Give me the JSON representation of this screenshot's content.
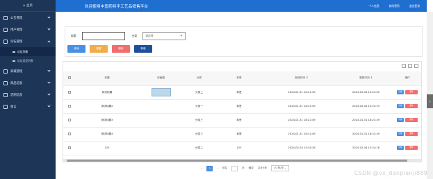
{
  "sidebar": {
    "home_label": "主页",
    "groups": [
      {
        "label": "公告管理",
        "icon": "grid-icon"
      },
      {
        "label": "用户管理",
        "icon": "grid-icon"
      },
      {
        "label": "论坛管理",
        "icon": "grid-icon",
        "open": true,
        "children": [
          {
            "label": "论坛列表",
            "active": true
          },
          {
            "label": "论坛类型列表",
            "active": false
          }
        ]
      },
      {
        "label": "商城管理",
        "icon": "grid-icon"
      },
      {
        "label": "商品信息",
        "icon": "grid-icon"
      },
      {
        "label": "定制信息",
        "icon": "grid-icon"
      },
      {
        "label": "留言",
        "icon": "grid-icon"
      }
    ]
  },
  "topbar": {
    "title": "欢迎使用中国药特手工艺品销售平台",
    "nav": [
      "个人信息",
      "修改密码",
      "退出登录"
    ]
  },
  "filter": {
    "title_label": "标题",
    "type_label": "分类",
    "type_placeholder": "请选择",
    "buttons": {
      "search": "查询",
      "reset": "重置",
      "delete": "删除",
      "add": "新增"
    }
  },
  "table": {
    "headers": [
      "",
      "标题",
      "封面图",
      "分类",
      "标签",
      "新增时间 ⇕",
      "更新时间 ⇕",
      "操作"
    ],
    "rows": [
      {
        "title": "测试标题",
        "has_image": true,
        "category": "分类二",
        "tag": "标签",
        "created": "2024-01-31 18:21:49",
        "updated": "2024-02-04 15:22:02"
      },
      {
        "title": "测试标题2",
        "has_image": false,
        "category": "分类一",
        "tag": "标签",
        "created": "2024-01-31 18:21:49",
        "updated": "2024-02-04 15:22:33"
      },
      {
        "title": "测试标题3",
        "has_image": false,
        "category": "分类三",
        "tag": "标签",
        "created": "2024-01-31 18:21:49",
        "updated": "2024-01-31 18:21:49"
      },
      {
        "title": "测试标题4",
        "has_image": false,
        "category": "分类三",
        "tag": "标签",
        "created": "2024-01-31 18:21:49",
        "updated": "2024-01-31 18:21:49"
      },
      {
        "title": "123",
        "has_image": false,
        "category": "分类二",
        "tag": "123",
        "created": "2024-02-04 15:24:16",
        "updated": "2024-02-04 15:24:16"
      }
    ],
    "op_edit": "详情",
    "op_delete": "删除"
  },
  "pager": {
    "current": "1",
    "goto_label": "前往",
    "page_suffix": "页",
    "confirm": "确定",
    "total": "共计5条",
    "page_size": "10 条/页"
  },
  "watermark": "CSDN @vx_danpianji889"
}
